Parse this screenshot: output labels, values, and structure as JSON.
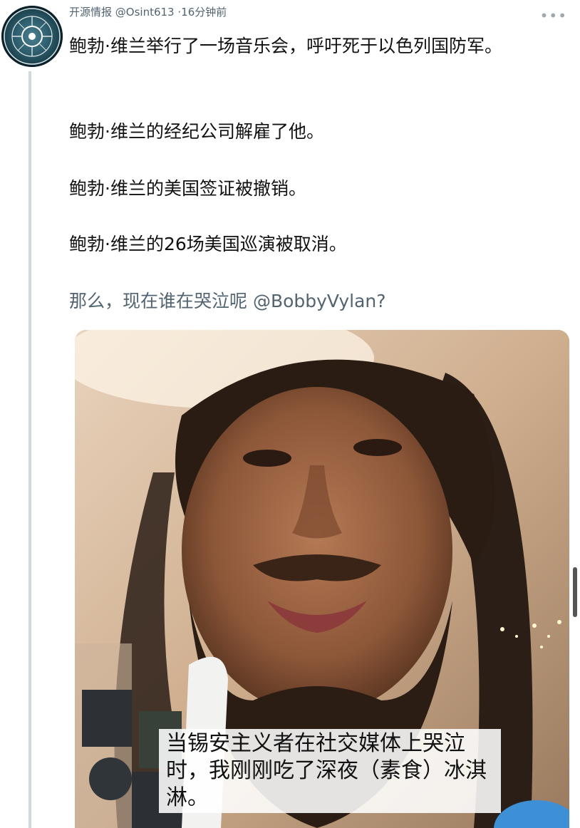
{
  "tweet": {
    "author_name": "开源情报",
    "handle": "@Osint613",
    "separator": "·",
    "time": "16分钟前",
    "more_label": "•••",
    "paragraphs": [
      "鲍勃·维兰举行了一场音乐会，呼吁死于以色列国防军。",
      "鲍勃·维兰的经纪公司解雇了他。",
      "鲍勃·维兰的美国签证被撤销。",
      "鲍勃·维兰的26场美国巡演被取消。"
    ],
    "closing_prefix": "那么，现在谁在哭泣呢 ",
    "closing_mention": "@BobbyVylan",
    "closing_suffix": "?"
  },
  "media": {
    "caption": "当锡安主义者在社交媒体上哭泣时，我刚刚吃了深夜（素食）冰淇淋。"
  },
  "colors": {
    "muted": "#536471",
    "thread_line": "#cfd9de",
    "avatar_ring": "#2f5f6e"
  }
}
